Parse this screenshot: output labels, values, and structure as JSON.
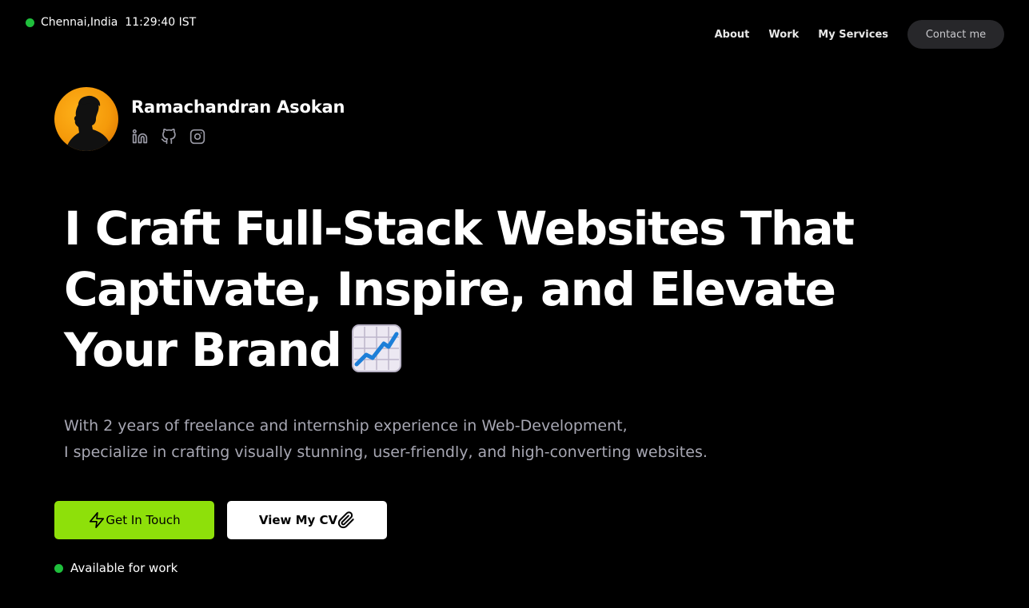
{
  "location": {
    "city": "Chennai,India",
    "time": "11:29:40 IST",
    "status_color": "#1fbf3c"
  },
  "nav": {
    "links": [
      "About",
      "Work",
      "My Services"
    ],
    "contact_label": "Contact me"
  },
  "profile": {
    "name": "Ramachandran Asokan",
    "socials": [
      "linkedin-icon",
      "github-icon",
      "instagram-icon"
    ]
  },
  "hero": {
    "line1": "I Craft Full-Stack Websites That",
    "line2": "Captivate, Inspire, and Elevate",
    "line3": "Your Brand",
    "emoji": "chart-increasing-icon"
  },
  "subtext": {
    "line1": "With 2 years of freelance and internship experience in Web-Development,",
    "line2": "I specialize in crafting visually stunning, user-friendly, and high-converting websites."
  },
  "buttons": {
    "touch_label": "Get In Touch",
    "cv_label": "View My CV"
  },
  "availability": "Available for work",
  "colors": {
    "accent": "#8ee00a",
    "status": "#1fbf3c",
    "background": "#000000"
  }
}
